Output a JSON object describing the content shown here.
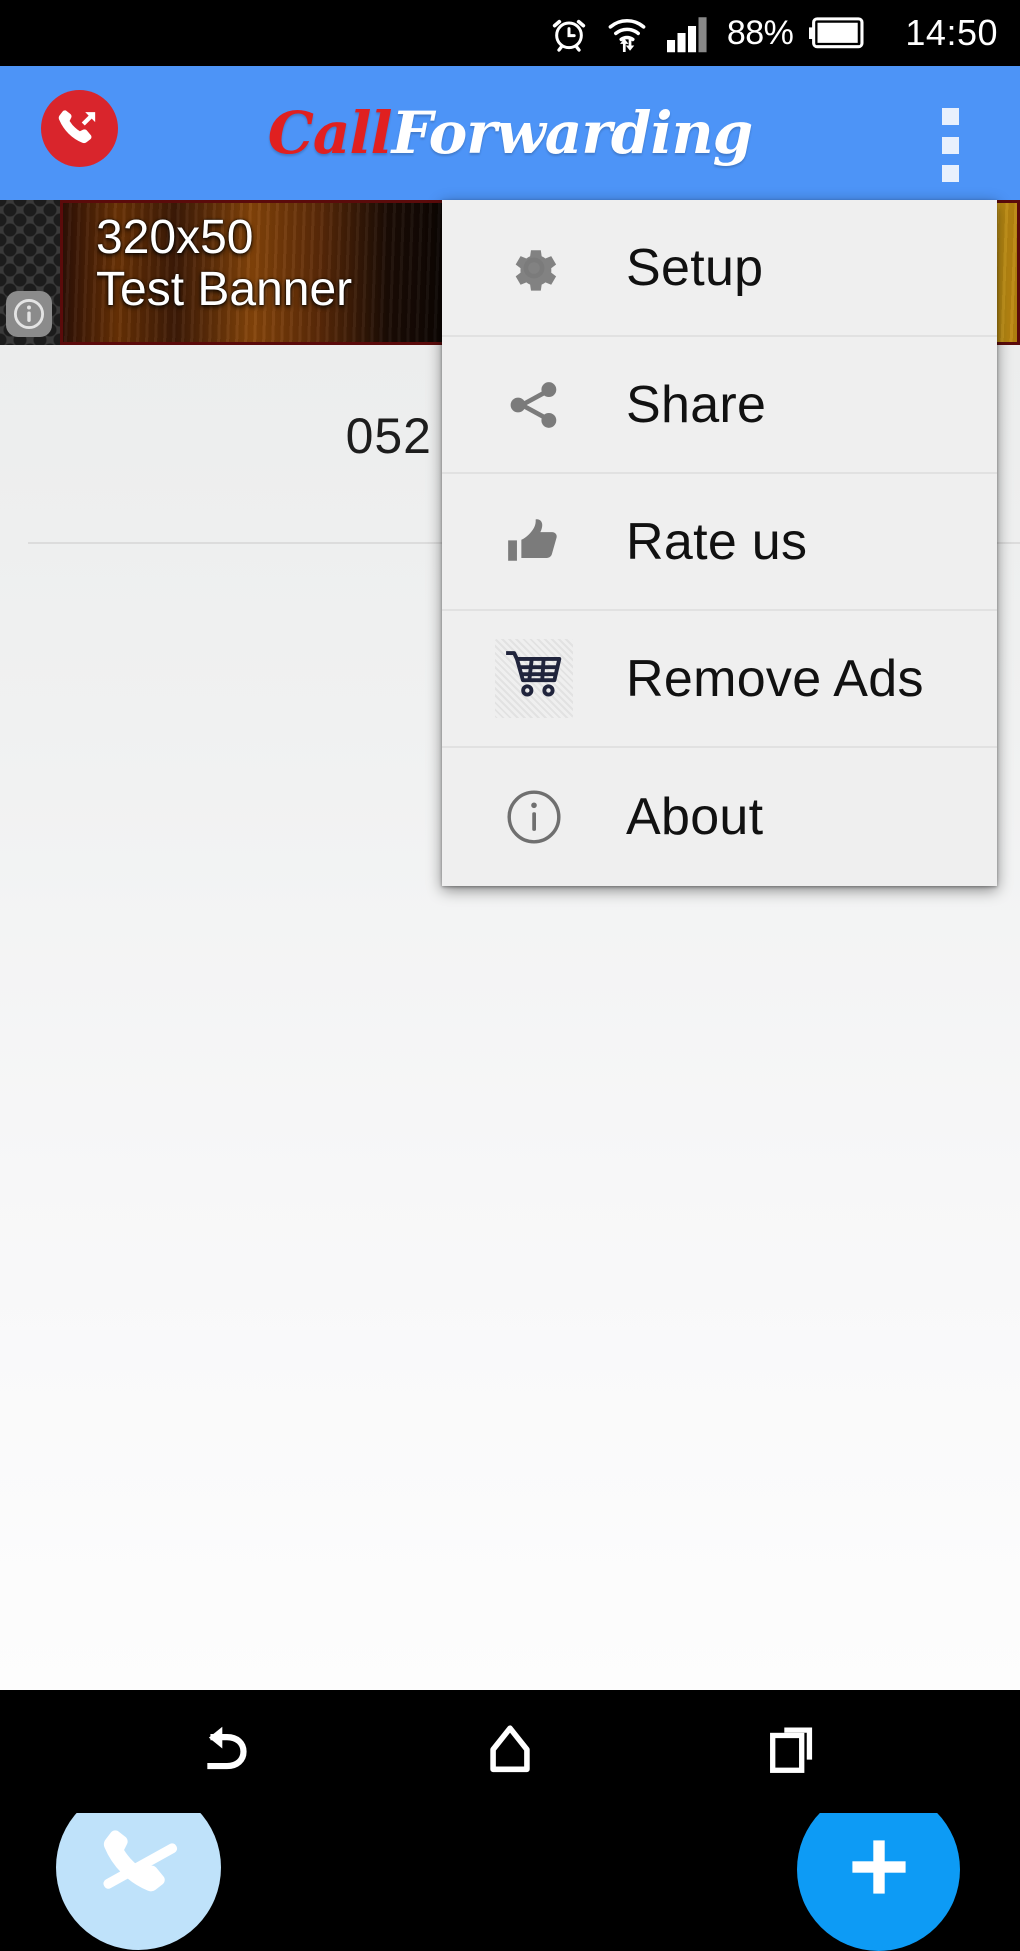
{
  "status_bar": {
    "alarm_icon": "alarm-clock-icon",
    "wifi_icon": "wifi-transfer-icon",
    "signal_icon": "cellular-signal-icon",
    "battery_percent": "88%",
    "battery_icon": "battery-icon",
    "time": "14:50"
  },
  "app_bar": {
    "logo_icon": "call-forward-logo-icon",
    "title_part1": "Call",
    "title_part2": "Forwarding",
    "overflow_icon": "overflow-menu-icon",
    "background_color": "#4d94f7",
    "logo_color": "#d9252c",
    "title_accent_color": "#e02020"
  },
  "ad_banner": {
    "info_icon": "ad-info-icon",
    "line1": "320x50",
    "line2": "Test Banner"
  },
  "content": {
    "rows": [
      {
        "number": "052"
      }
    ]
  },
  "fabs": {
    "disable": {
      "icon": "call-disable-icon",
      "color": "#bfe2fa"
    },
    "add": {
      "icon": "plus-icon",
      "color": "#0d9bf5"
    }
  },
  "overflow_menu": {
    "items": [
      {
        "icon": "gear-icon",
        "label": "Setup"
      },
      {
        "icon": "share-icon",
        "label": "Share"
      },
      {
        "icon": "thumbs-up-icon",
        "label": "Rate us"
      },
      {
        "icon": "shopping-cart-icon",
        "label": "Remove Ads"
      },
      {
        "icon": "info-circle-icon",
        "label": "About"
      }
    ]
  },
  "nav_bar": {
    "back_icon": "back-arrow-icon",
    "home_icon": "home-icon",
    "recents_icon": "recent-apps-icon"
  }
}
